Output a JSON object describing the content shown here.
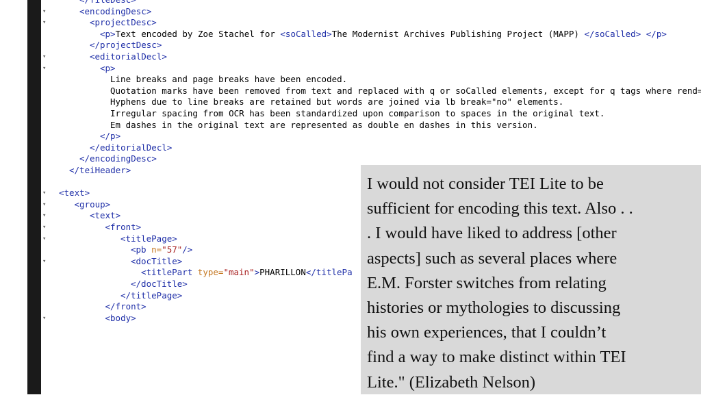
{
  "editor": {
    "lines": [
      {
        "fold": "",
        "indent": 4,
        "parts": [
          [
            "tag",
            "</fileDesc>"
          ]
        ]
      },
      {
        "fold": "▾",
        "indent": 4,
        "parts": [
          [
            "tag",
            "<encodingDesc>"
          ]
        ]
      },
      {
        "fold": "▾",
        "indent": 6,
        "parts": [
          [
            "tag",
            "<projectDesc>"
          ]
        ]
      },
      {
        "fold": "",
        "indent": 8,
        "parts": [
          [
            "tag",
            "<p>"
          ],
          [
            "txt",
            "Text encoded by Zoe Stachel for "
          ],
          [
            "tag",
            "<soCalled>"
          ],
          [
            "txt",
            "The Modernist Archives Publishing Project (MAPP) "
          ],
          [
            "tag",
            "</soCalled>"
          ],
          [
            "txt",
            " "
          ],
          [
            "tag",
            "</p>"
          ]
        ]
      },
      {
        "fold": "",
        "indent": 6,
        "parts": [
          [
            "tag",
            "</projectDesc>"
          ]
        ]
      },
      {
        "fold": "▾",
        "indent": 6,
        "parts": [
          [
            "tag",
            "<editorialDecl>"
          ]
        ]
      },
      {
        "fold": "▾",
        "indent": 8,
        "parts": [
          [
            "tag",
            "<p>"
          ]
        ]
      },
      {
        "fold": "",
        "indent": 10,
        "parts": [
          [
            "txt",
            "Line breaks and page breaks have been encoded."
          ]
        ]
      },
      {
        "fold": "",
        "indent": 10,
        "parts": [
          [
            "txt",
            "Quotation marks have been removed from text and replaced with q or soCalled elements, except for q tags where rend=\"bl"
          ]
        ]
      },
      {
        "fold": "",
        "indent": 10,
        "parts": [
          [
            "txt",
            "Hyphens due to line breaks are retained but words are joined via lb break=\"no\" elements."
          ]
        ]
      },
      {
        "fold": "",
        "indent": 10,
        "parts": [
          [
            "txt",
            "Irregular spacing from OCR has been standardized upon comparison to spaces in the original text."
          ]
        ]
      },
      {
        "fold": "",
        "indent": 10,
        "parts": [
          [
            "txt",
            "Em dashes in the original text are represented as double en dashes in this version."
          ]
        ]
      },
      {
        "fold": "",
        "indent": 8,
        "parts": [
          [
            "tag",
            "</p>"
          ]
        ]
      },
      {
        "fold": "",
        "indent": 6,
        "parts": [
          [
            "tag",
            "</editorialDecl>"
          ]
        ]
      },
      {
        "fold": "",
        "indent": 4,
        "parts": [
          [
            "tag",
            "</encodingDesc>"
          ]
        ]
      },
      {
        "fold": "",
        "indent": 2,
        "parts": [
          [
            "tag",
            "</teiHeader>"
          ]
        ]
      },
      {
        "fold": "",
        "indent": 0,
        "parts": []
      },
      {
        "fold": "▾",
        "indent": 0,
        "parts": [
          [
            "tag",
            "<text>"
          ]
        ]
      },
      {
        "fold": "▾",
        "indent": 3,
        "parts": [
          [
            "tag",
            "<group>"
          ]
        ]
      },
      {
        "fold": "▾",
        "indent": 6,
        "parts": [
          [
            "tag",
            "<text>"
          ]
        ]
      },
      {
        "fold": "▾",
        "indent": 9,
        "parts": [
          [
            "tag",
            "<front>"
          ]
        ]
      },
      {
        "fold": "▾",
        "indent": 12,
        "parts": [
          [
            "tag",
            "<titlePage>"
          ]
        ]
      },
      {
        "fold": "",
        "indent": 14,
        "parts": [
          [
            "tag",
            "<pb "
          ],
          [
            "attr",
            "n="
          ],
          [
            "val",
            "\"57\""
          ],
          [
            "tag",
            "/>"
          ]
        ]
      },
      {
        "fold": "▾",
        "indent": 14,
        "parts": [
          [
            "tag",
            "<docTitle>"
          ]
        ]
      },
      {
        "fold": "",
        "indent": 16,
        "parts": [
          [
            "tag",
            "<titlePart "
          ],
          [
            "attr",
            "type="
          ],
          [
            "val",
            "\"main\""
          ],
          [
            "tag",
            ">"
          ],
          [
            "txt",
            "PHARILLON"
          ],
          [
            "tag",
            "</titlePa"
          ]
        ]
      },
      {
        "fold": "",
        "indent": 14,
        "parts": [
          [
            "tag",
            "</docTitle>"
          ]
        ]
      },
      {
        "fold": "",
        "indent": 12,
        "parts": [
          [
            "tag",
            "</titlePage>"
          ]
        ]
      },
      {
        "fold": "",
        "indent": 9,
        "parts": [
          [
            "tag",
            "</front>"
          ]
        ]
      },
      {
        "fold": "▾",
        "indent": 9,
        "parts": [
          [
            "tag",
            "<body>"
          ]
        ]
      }
    ]
  },
  "quote": {
    "lines": [
      "I would not consider TEI Lite to be",
      "sufficient for encoding this text. Also . .",
      ". I would have liked to address [other",
      "aspects] such as several places where",
      "E.M. Forster switches from relating",
      "histories or mythologies to discussing",
      "his own experiences, that I couldn’t",
      "find a way to make distinct within TEI",
      "Lite.\" (Elizabeth Nelson)"
    ]
  },
  "colors": {
    "tag": "#1f2fa8",
    "attribute": "#c4761f",
    "value": "#a82020",
    "quote_background": "#d9d9d9"
  }
}
